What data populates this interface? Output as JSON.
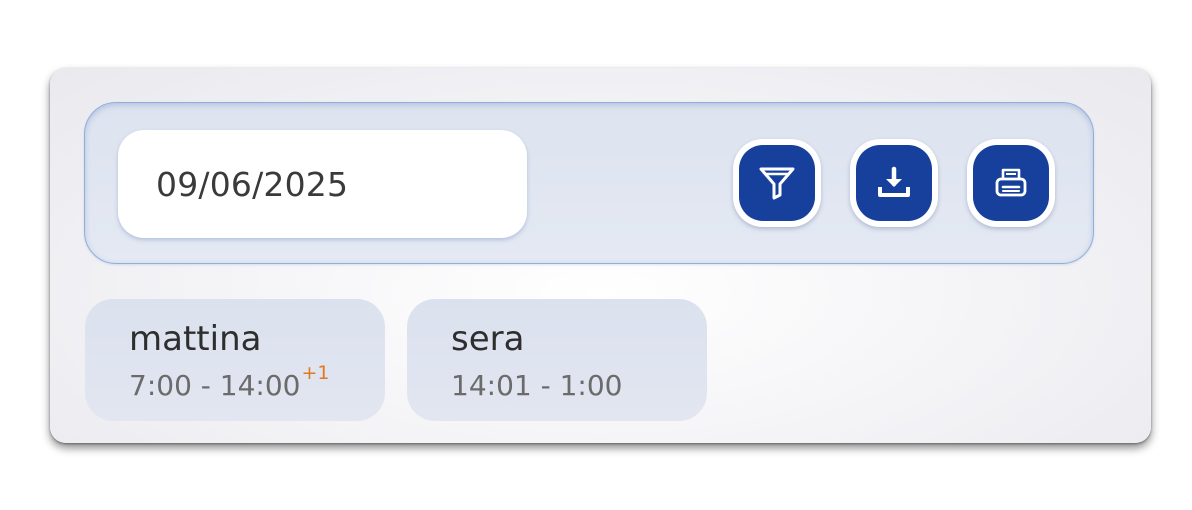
{
  "date_input": {
    "value": "09/06/2025"
  },
  "toolbar": {
    "buttons": [
      {
        "icon": "filter-icon"
      },
      {
        "icon": "download-icon"
      },
      {
        "icon": "print-icon"
      }
    ],
    "button_color": "#16409c"
  },
  "shifts": [
    {
      "name": "mattina",
      "time": "7:00 - 14:00",
      "next_day_marker": "+1"
    },
    {
      "name": "sera",
      "time": "14:01 - 1:00"
    }
  ],
  "colors": {
    "accent": "#16409c",
    "marker": "#e07a1e"
  }
}
